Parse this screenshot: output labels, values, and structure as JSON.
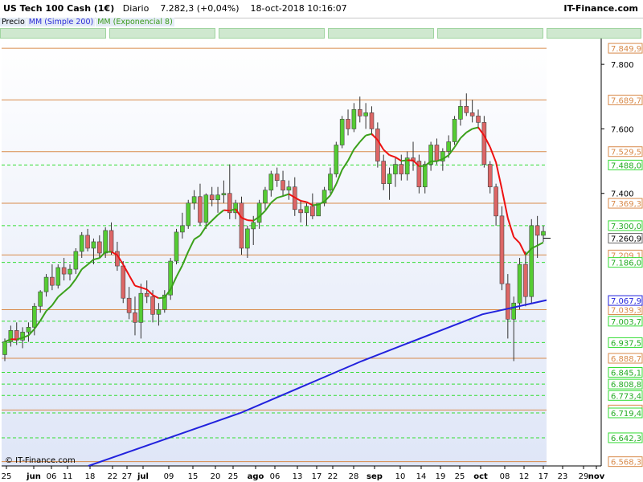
{
  "header": {
    "title_main": "US Tech 100 Cash (1€)",
    "period": "Diario",
    "price": "7.282,3 (+0,04%)",
    "datetime": "18-oct-2018 10:16:07",
    "brand": "IT-Finance.com"
  },
  "legend": [
    {
      "label": "Precio",
      "color": "#000000"
    },
    {
      "label": "MM (Simple 200)",
      "color": "#2a2ad8"
    },
    {
      "label": "MM (Exponencial 8)",
      "color": "#3a9a1a"
    }
  ],
  "copyright": "© IT-Finance.com",
  "colors": {
    "orange_level": "#d88a4a",
    "green_level": "#33dd33",
    "sma200": "#2222dd",
    "ema8": "#3aa01a",
    "ema_red": "#ee1111",
    "candle_up": "#55cc33",
    "candle_down": "#dd6666"
  },
  "chart_data": {
    "type": "candlestick",
    "ylim": [
      6555,
      7880
    ],
    "y_ticks": [
      "7.800",
      "7.600",
      "7.400"
    ],
    "x_tick_labels": [
      "25",
      "jun",
      "06",
      "11",
      "18",
      "22",
      "27",
      "jul",
      "09",
      "15",
      "20",
      "25",
      "ago",
      "06",
      "13",
      "17",
      "22",
      "28",
      "sep",
      "10",
      "14",
      "19",
      "25",
      "oct",
      "08",
      "12",
      "17",
      "23",
      "29",
      "nov"
    ],
    "orange_levels": [
      {
        "label": "7.849,9",
        "value": 7849.9
      },
      {
        "label": "7.689,7",
        "value": 7689.7
      },
      {
        "label": "7.529,5",
        "value": 7529.5
      },
      {
        "label": "7.369,3",
        "value": 7369.3
      },
      {
        "label": "7.209,1",
        "value": 7209.1
      },
      {
        "label": "7.039,3",
        "value": 7039.3
      },
      {
        "label": "6.888,7",
        "value": 6888.7
      },
      {
        "label": "6.728,5",
        "value": 6728.5
      },
      {
        "label": "6.568,3",
        "value": 6568.3
      }
    ],
    "green_levels": [
      {
        "label": "7.488,0",
        "value": 7488.0
      },
      {
        "label": "7.300,0",
        "value": 7300.0
      },
      {
        "label": "7.186,0",
        "value": 7186.0
      },
      {
        "label": "7.003,7",
        "value": 7003.7
      },
      {
        "label": "6.937,5",
        "value": 6937.5
      },
      {
        "label": "6.845,1",
        "value": 6845.1
      },
      {
        "label": "6.808,8",
        "value": 6808.8
      },
      {
        "label": "6.773,4",
        "value": 6773.4
      },
      {
        "label": "6.719,4",
        "value": 6719.4
      },
      {
        "label": "6.642,3",
        "value": 6642.3
      }
    ],
    "current_price": {
      "label": "7.260,9",
      "value": 7260.9
    },
    "sma200_label": {
      "label": "7.067,9",
      "value": 7067.9
    },
    "candles": [
      [
        6900,
        6950,
        6880,
        6940
      ],
      [
        6940,
        6990,
        6925,
        6975
      ],
      [
        6975,
        7000,
        6930,
        6945
      ],
      [
        6945,
        6985,
        6920,
        6970
      ],
      [
        6970,
        7000,
        6940,
        6985
      ],
      [
        6985,
        7060,
        6960,
        7050
      ],
      [
        7050,
        7100,
        7030,
        7095
      ],
      [
        7095,
        7150,
        7080,
        7140
      ],
      [
        7140,
        7180,
        7100,
        7115
      ],
      [
        7115,
        7180,
        7105,
        7170
      ],
      [
        7170,
        7200,
        7130,
        7150
      ],
      [
        7150,
        7180,
        7130,
        7165
      ],
      [
        7165,
        7230,
        7150,
        7220
      ],
      [
        7220,
        7280,
        7200,
        7270
      ],
      [
        7270,
        7290,
        7220,
        7230
      ],
      [
        7230,
        7260,
        7180,
        7250
      ],
      [
        7250,
        7270,
        7200,
        7215
      ],
      [
        7215,
        7295,
        7200,
        7285
      ],
      [
        7285,
        7310,
        7210,
        7220
      ],
      [
        7220,
        7250,
        7160,
        7175
      ],
      [
        7175,
        7190,
        7060,
        7075
      ],
      [
        7075,
        7110,
        7010,
        7030
      ],
      [
        7030,
        7080,
        6960,
        7000
      ],
      [
        7000,
        7120,
        6950,
        7090
      ],
      [
        7090,
        7130,
        7060,
        7080
      ],
      [
        7080,
        7100,
        7000,
        7025
      ],
      [
        7025,
        7060,
        6990,
        7040
      ],
      [
        7040,
        7100,
        7030,
        7085
      ],
      [
        7085,
        7200,
        7070,
        7190
      ],
      [
        7190,
        7290,
        7180,
        7280
      ],
      [
        7280,
        7340,
        7260,
        7300
      ],
      [
        7300,
        7380,
        7290,
        7370
      ],
      [
        7370,
        7410,
        7350,
        7390
      ],
      [
        7390,
        7430,
        7300,
        7310
      ],
      [
        7310,
        7400,
        7290,
        7395
      ],
      [
        7395,
        7420,
        7360,
        7380
      ],
      [
        7380,
        7420,
        7340,
        7395
      ],
      [
        7395,
        7440,
        7370,
        7400
      ],
      [
        7400,
        7490,
        7320,
        7340
      ],
      [
        7340,
        7380,
        7320,
        7370
      ],
      [
        7370,
        7390,
        7210,
        7230
      ],
      [
        7230,
        7300,
        7200,
        7290
      ],
      [
        7290,
        7330,
        7240,
        7310
      ],
      [
        7310,
        7380,
        7290,
        7370
      ],
      [
        7370,
        7420,
        7350,
        7410
      ],
      [
        7410,
        7470,
        7390,
        7460
      ],
      [
        7460,
        7480,
        7420,
        7440
      ],
      [
        7440,
        7470,
        7390,
        7410
      ],
      [
        7410,
        7440,
        7380,
        7420
      ],
      [
        7420,
        7450,
        7330,
        7350
      ],
      [
        7350,
        7380,
        7310,
        7340
      ],
      [
        7340,
        7370,
        7300,
        7360
      ],
      [
        7360,
        7400,
        7320,
        7330
      ],
      [
        7330,
        7360,
        7330,
        7370
      ],
      [
        7370,
        7420,
        7360,
        7410
      ],
      [
        7410,
        7480,
        7400,
        7460
      ],
      [
        7460,
        7560,
        7450,
        7550
      ],
      [
        7550,
        7640,
        7540,
        7630
      ],
      [
        7630,
        7660,
        7580,
        7600
      ],
      [
        7600,
        7680,
        7590,
        7660
      ],
      [
        7660,
        7700,
        7620,
        7640
      ],
      [
        7640,
        7680,
        7600,
        7650
      ],
      [
        7650,
        7670,
        7580,
        7600
      ],
      [
        7600,
        7620,
        7480,
        7500
      ],
      [
        7500,
        7520,
        7410,
        7430
      ],
      [
        7430,
        7480,
        7380,
        7460
      ],
      [
        7460,
        7510,
        7420,
        7490
      ],
      [
        7490,
        7520,
        7440,
        7460
      ],
      [
        7460,
        7530,
        7440,
        7510
      ],
      [
        7510,
        7560,
        7470,
        7500
      ],
      [
        7500,
        7520,
        7400,
        7420
      ],
      [
        7420,
        7500,
        7400,
        7490
      ],
      [
        7490,
        7560,
        7470,
        7550
      ],
      [
        7550,
        7570,
        7490,
        7500
      ],
      [
        7500,
        7540,
        7470,
        7530
      ],
      [
        7530,
        7580,
        7510,
        7560
      ],
      [
        7560,
        7640,
        7550,
        7630
      ],
      [
        7630,
        7690,
        7610,
        7670
      ],
      [
        7670,
        7710,
        7640,
        7650
      ],
      [
        7650,
        7690,
        7620,
        7640
      ],
      [
        7640,
        7660,
        7600,
        7620
      ],
      [
        7620,
        7640,
        7480,
        7490
      ],
      [
        7490,
        7500,
        7400,
        7420
      ],
      [
        7420,
        7430,
        7300,
        7330
      ],
      [
        7330,
        7360,
        7100,
        7120
      ],
      [
        7120,
        7150,
        6950,
        7010
      ],
      [
        7010,
        7080,
        6880,
        7060
      ],
      [
        7060,
        7200,
        7040,
        7180
      ],
      [
        7180,
        7220,
        7050,
        7080
      ],
      [
        7080,
        7320,
        7060,
        7300
      ],
      [
        7300,
        7330,
        7200,
        7270
      ],
      [
        7270,
        7300,
        7250,
        7282
      ]
    ]
  }
}
